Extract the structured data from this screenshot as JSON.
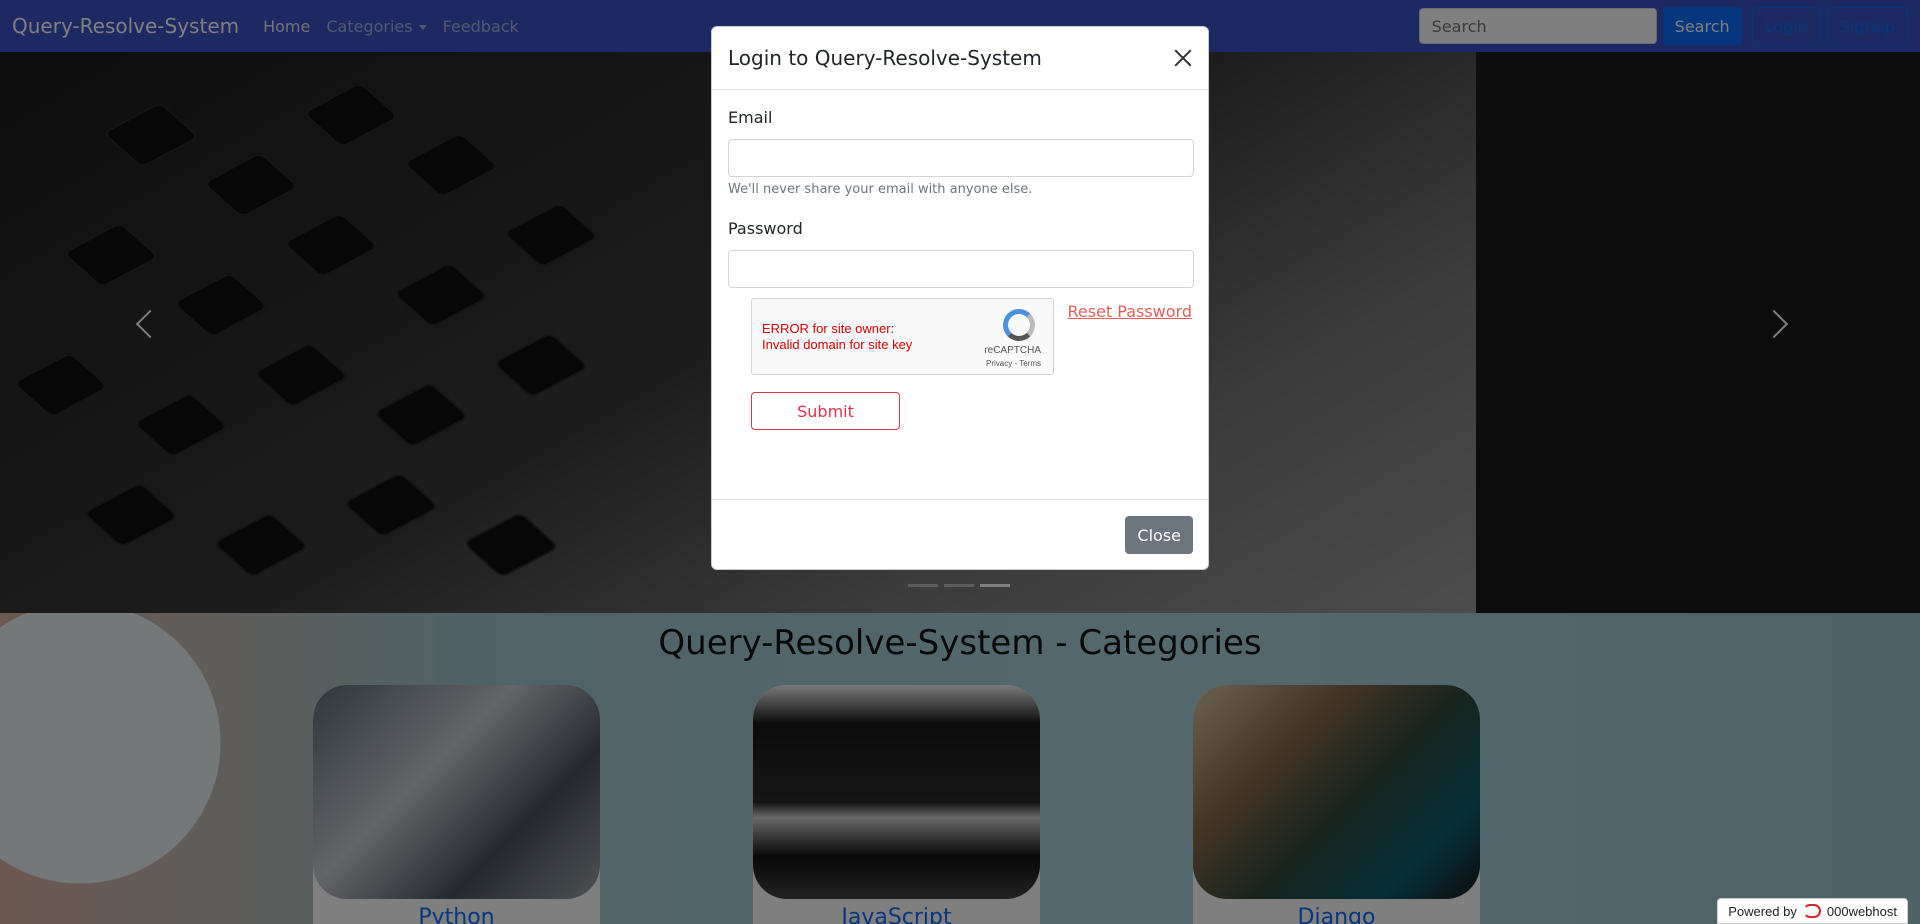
{
  "navbar": {
    "brand": "Query-Resolve-System",
    "links": [
      "Home",
      "Categories",
      "Feedback"
    ],
    "search_placeholder": "Search",
    "search_button": "Search",
    "login_button": "Login",
    "signup_button": "Signup"
  },
  "carousel": {
    "indicators": 3,
    "active_indicator": 3
  },
  "categories": {
    "title": "Query-Resolve-System - Categories",
    "cards": [
      "Python",
      "JavaScript",
      "Django"
    ]
  },
  "modal": {
    "title": "Login to Query-Resolve-System",
    "email_label": "Email",
    "email_value": "",
    "email_help": "We'll never share your email with anyone else.",
    "password_label": "Password",
    "password_value": "",
    "reset_link": "Reset Password",
    "recaptcha": {
      "error_line1": "ERROR for site owner:",
      "error_line2": "Invalid domain for site key",
      "brand": "reCAPTCHA",
      "links": "Privacy - Terms"
    },
    "submit_button": "Submit",
    "close_button": "Close"
  },
  "footer_badge": {
    "text": "Powered by",
    "brand": "000webhost"
  },
  "colors": {
    "navbar": "#3a53c4",
    "primary": "#0d6efd",
    "danger": "#dc3545",
    "secondary": "#6c757d"
  }
}
